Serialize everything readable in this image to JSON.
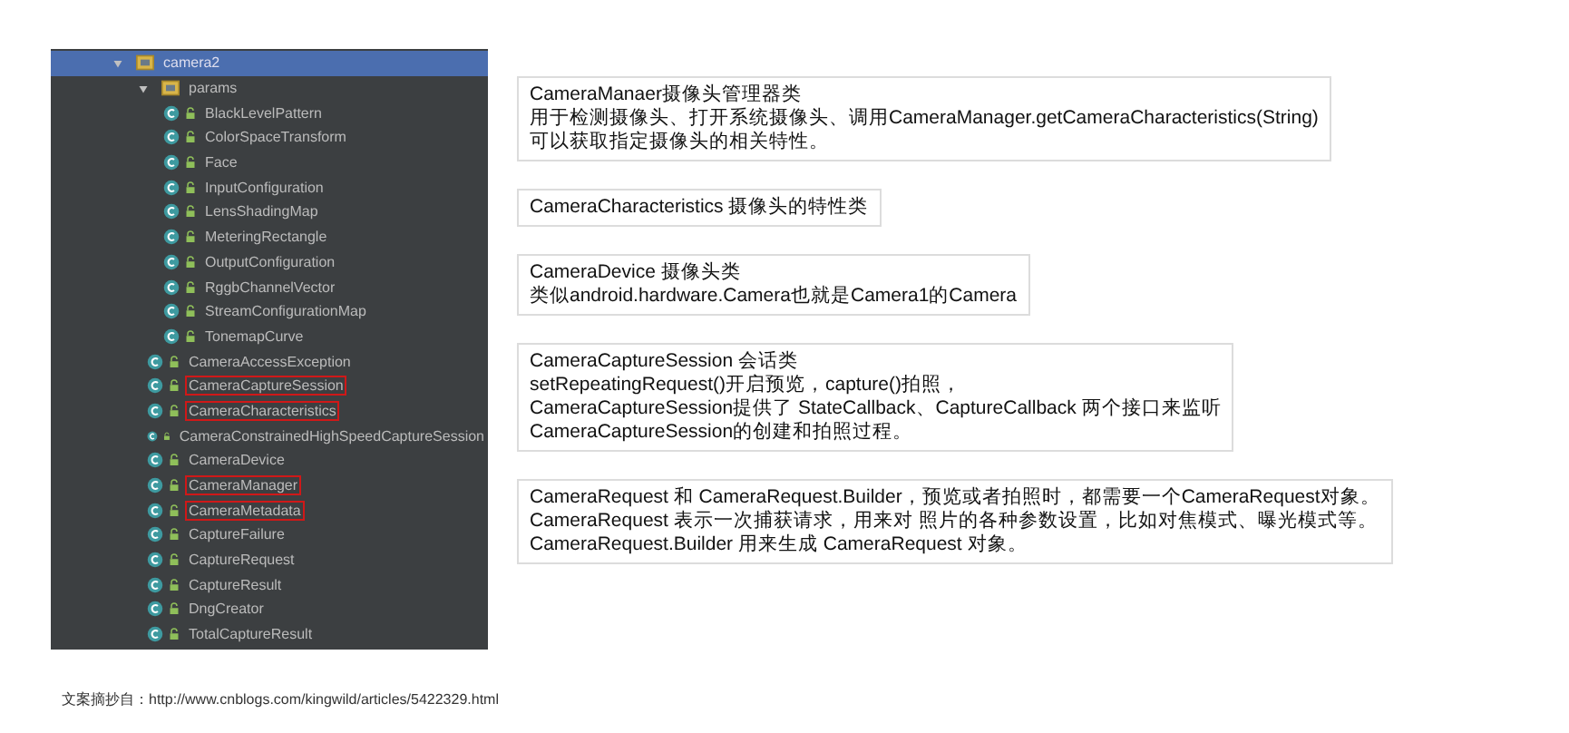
{
  "tree": [
    {
      "label": "camera2",
      "kind": "package",
      "expanded": true,
      "selected": true,
      "children": [
        {
          "label": "params",
          "kind": "package",
          "expanded": true,
          "selected": false,
          "children": [
            {
              "label": "BlackLevelPattern",
              "kind": "class",
              "selected": false,
              "highlighted": false
            },
            {
              "label": "ColorSpaceTransform",
              "kind": "class",
              "selected": false,
              "highlighted": false
            },
            {
              "label": "Face",
              "kind": "class",
              "selected": false,
              "highlighted": false
            },
            {
              "label": "InputConfiguration",
              "kind": "class",
              "selected": false,
              "highlighted": false
            },
            {
              "label": "LensShadingMap",
              "kind": "class",
              "selected": false,
              "highlighted": false
            },
            {
              "label": "MeteringRectangle",
              "kind": "class",
              "selected": false,
              "highlighted": false
            },
            {
              "label": "OutputConfiguration",
              "kind": "class",
              "selected": false,
              "highlighted": false
            },
            {
              "label": "RggbChannelVector",
              "kind": "class",
              "selected": false,
              "highlighted": false
            },
            {
              "label": "StreamConfigurationMap",
              "kind": "class",
              "selected": false,
              "highlighted": false
            },
            {
              "label": "TonemapCurve",
              "kind": "class",
              "selected": false,
              "highlighted": false
            }
          ]
        },
        {
          "label": "CameraAccessException",
          "kind": "class",
          "selected": false,
          "highlighted": false
        },
        {
          "label": "CameraCaptureSession",
          "kind": "class",
          "selected": false,
          "highlighted": true
        },
        {
          "label": "CameraCharacteristics",
          "kind": "class",
          "selected": false,
          "highlighted": true
        },
        {
          "label": "CameraConstrainedHighSpeedCaptureSession",
          "kind": "class",
          "selected": false,
          "highlighted": false
        },
        {
          "label": "CameraDevice",
          "kind": "class",
          "selected": false,
          "highlighted": false
        },
        {
          "label": "CameraManager",
          "kind": "class",
          "selected": false,
          "highlighted": true
        },
        {
          "label": "CameraMetadata",
          "kind": "class",
          "selected": false,
          "highlighted": true
        },
        {
          "label": "CaptureFailure",
          "kind": "class",
          "selected": false,
          "highlighted": false
        },
        {
          "label": "CaptureRequest",
          "kind": "class",
          "selected": false,
          "highlighted": false
        },
        {
          "label": "CaptureResult",
          "kind": "class",
          "selected": false,
          "highlighted": false
        },
        {
          "label": "DngCreator",
          "kind": "class",
          "selected": false,
          "highlighted": false
        },
        {
          "label": "TotalCaptureResult",
          "kind": "class",
          "selected": false,
          "highlighted": false
        }
      ]
    }
  ],
  "notes": [
    {
      "lines": [
        "CameraManaer摄像头管理器类",
        "用于检测摄像头、打开系统摄像头、调用CameraManager.getCameraCharacteristics(String)",
        "可以获取指定摄像头的相关特性。"
      ]
    },
    {
      "lines": [
        "CameraCharacteristics 摄像头的特性类"
      ]
    },
    {
      "lines": [
        "CameraDevice 摄像头类",
        "类似android.hardware.Camera也就是Camera1的Camera"
      ]
    },
    {
      "lines": [
        "CameraCaptureSession 会话类",
        "setRepeatingRequest()开启预览，capture()拍照，",
        "CameraCaptureSession提供了 StateCallback、CaptureCallback 两个接口来监听",
        "CameraCaptureSession的创建和拍照过程。"
      ]
    },
    {
      "lines": [
        "CameraRequest 和 CameraRequest.Builder，预览或者拍照时，都需要一个CameraRequest对象。",
        "CameraRequest 表示一次捕获请求，用来对 照片的各种参数设置，比如对焦模式、曝光模式等。",
        "CameraRequest.Builder 用来生成 CameraRequest 对象。"
      ]
    }
  ],
  "source": "文案摘抄自：http://www.cnblogs.com/kingwild/articles/5422329.html"
}
